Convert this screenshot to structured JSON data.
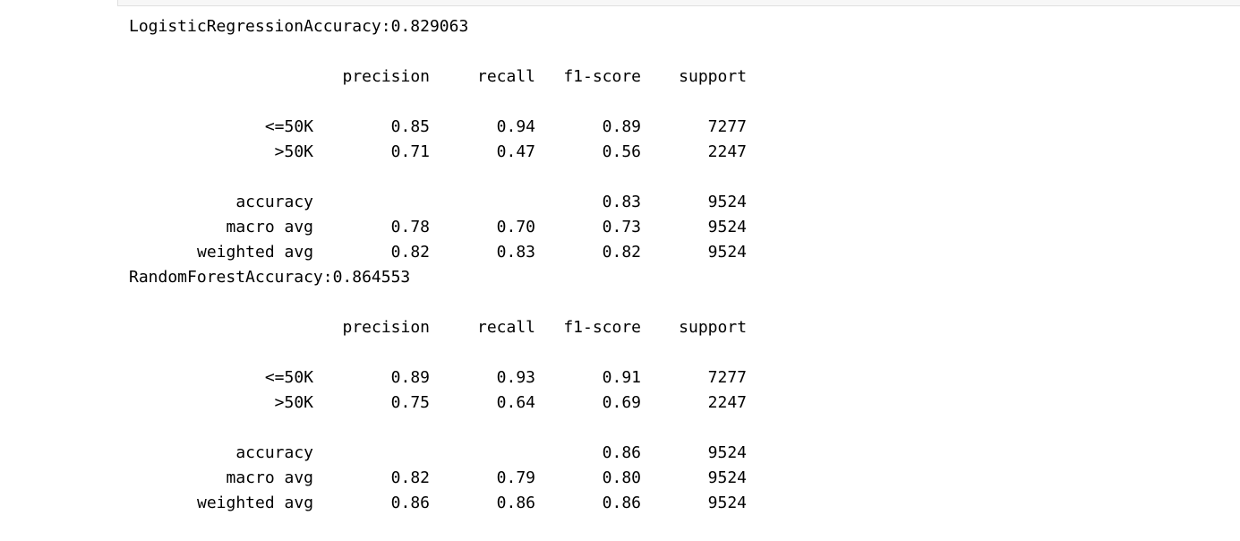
{
  "reports": [
    {
      "accuracy_line": "LogisticRegressionAccuracy:0.829063",
      "headers": [
        "",
        "precision",
        "recall",
        "f1-score",
        "support"
      ],
      "class_rows": [
        [
          "<=50K",
          "0.85",
          "0.94",
          "0.89",
          "7277"
        ],
        [
          ">50K",
          "0.71",
          "0.47",
          "0.56",
          "2247"
        ]
      ],
      "summary_rows": [
        [
          "accuracy",
          "",
          "",
          "0.83",
          "9524"
        ],
        [
          "macro avg",
          "0.78",
          "0.70",
          "0.73",
          "9524"
        ],
        [
          "weighted avg",
          "0.82",
          "0.83",
          "0.82",
          "9524"
        ]
      ]
    },
    {
      "accuracy_line": "RandomForestAccuracy:0.864553",
      "headers": [
        "",
        "precision",
        "recall",
        "f1-score",
        "support"
      ],
      "class_rows": [
        [
          "<=50K",
          "0.89",
          "0.93",
          "0.91",
          "7277"
        ],
        [
          ">50K",
          "0.75",
          "0.64",
          "0.69",
          "2247"
        ]
      ],
      "summary_rows": [
        [
          "accuracy",
          "",
          "",
          "0.86",
          "9524"
        ],
        [
          "macro avg",
          "0.82",
          "0.79",
          "0.80",
          "9524"
        ],
        [
          "weighted avg",
          "0.86",
          "0.86",
          "0.86",
          "9524"
        ]
      ]
    }
  ]
}
